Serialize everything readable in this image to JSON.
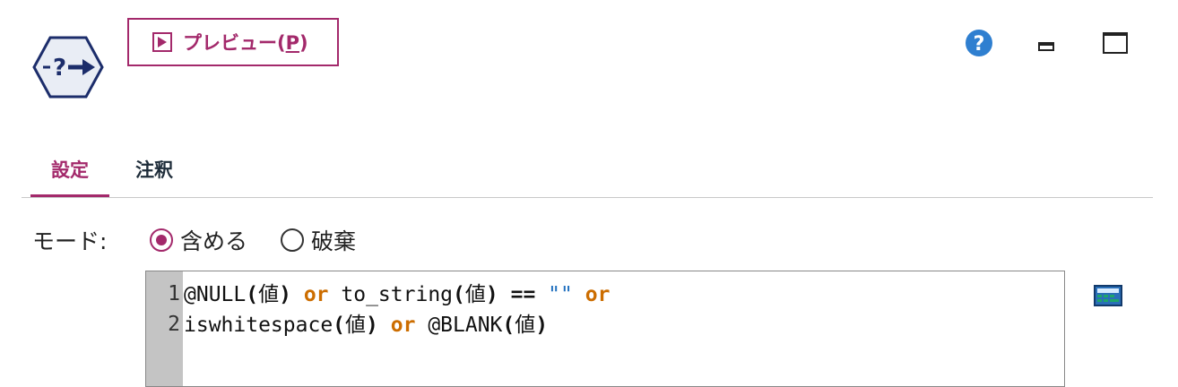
{
  "toolbar": {
    "preview_label": "プレビュー(",
    "preview_mnemonic": "P",
    "preview_close": ")"
  },
  "window_controls": {
    "help": "help-icon",
    "minimize": "minimize-icon",
    "maximize": "maximize-icon"
  },
  "tabs": [
    {
      "label": "設定",
      "active": true
    },
    {
      "label": "注釈",
      "active": false
    }
  ],
  "mode": {
    "label": "モード:",
    "options": [
      {
        "label": "含める",
        "selected": true
      },
      {
        "label": "破棄",
        "selected": false
      }
    ]
  },
  "editor": {
    "line_numbers": [
      "1",
      "2"
    ],
    "line1": {
      "t1": "@NULL",
      "p1": "(",
      "t2": "値",
      "p2": ")",
      "kw1": "or",
      "t3": "to_string",
      "p3": "(",
      "t4": "値",
      "p4": ")",
      "op1": "==",
      "str1": "\"\"",
      "kw2": "or"
    },
    "line2": {
      "t1": "iswhitespace",
      "p1": "(",
      "t2": "値",
      "p2": ")",
      "kw1": "or",
      "t3": "@BLANK",
      "p3": "(",
      "t4": "値",
      "p4": ")"
    }
  },
  "colors": {
    "accent": "#a3296b",
    "keyword": "#cc6d00",
    "string": "#1f6fbf",
    "help": "#2f7fd0",
    "node_icon": "#1c2d6b"
  }
}
